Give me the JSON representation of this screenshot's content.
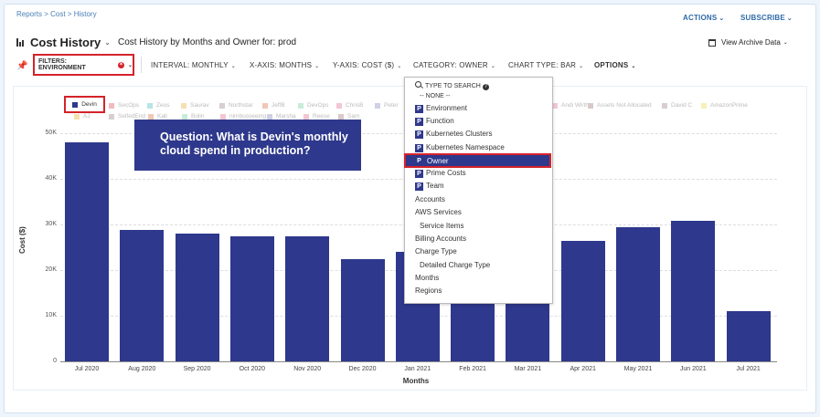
{
  "breadcrumb": "Reports > Cost > History",
  "header": {
    "actions_label": "ACTIONS",
    "subscribe_label": "SUBSCRIBE",
    "title": "Cost History",
    "subtitle": "Cost History by Months and Owner for: prod",
    "archive_label": "View Archive Data"
  },
  "toolbar": {
    "filter_label": "FILTERS: ENVIRONMENT",
    "interval_label": "INTERVAL:",
    "interval_value": "MONTHLY",
    "xaxis_label": "X-AXIS:",
    "xaxis_value": "MONTHS",
    "yaxis_label": "Y-AXIS:",
    "yaxis_value": "COST ($)",
    "category_label": "CATEGORY:",
    "category_value": "OWNER",
    "charttype_label": "CHART TYPE:",
    "charttype_value": "BAR",
    "options_label": "OPTIONS"
  },
  "legend": {
    "row1": [
      "Devin",
      "SecOps",
      "Zeus",
      "Saurav",
      "Northstar",
      "JeffB",
      "DevOps",
      "ChrisB",
      "Peter"
    ],
    "row1_right": [
      "Andi Wirth",
      "Assets Not Allocated",
      "David C",
      "AmazonPrime"
    ],
    "row2": [
      "AJ",
      "SelfedEnd",
      "Kali",
      "Bolin",
      "nimbusseeing",
      "Marsha",
      "Reese",
      "Sam"
    ],
    "colors": [
      "#2e388c",
      "#f4b8c0",
      "#b7e4e6",
      "#f6dfb0",
      "#d7cfcf",
      "#f2c7b5",
      "#c9ecd9",
      "#f3c6d2",
      "#cfd0e6",
      "#f3c6d2",
      "#d9c9c9",
      "#d7cfcf",
      "#f6f0b8"
    ]
  },
  "dropdown": {
    "search_placeholder": "TYPE TO SEARCH",
    "none_label": "-- NONE --",
    "prefixed": [
      "Environment",
      "Function",
      "Kubernetes Clusters",
      "Kubernetes Namespace",
      "Owner",
      "Prime Costs",
      "Team"
    ],
    "badge": "P",
    "selected": "Owner",
    "plain": [
      {
        "label": "Accounts",
        "sub": false
      },
      {
        "label": "AWS Services",
        "sub": false
      },
      {
        "label": "Service Items",
        "sub": true
      },
      {
        "label": "Billing Accounts",
        "sub": false
      },
      {
        "label": "Charge Type",
        "sub": false
      },
      {
        "label": "Detailed Charge Type",
        "sub": true
      },
      {
        "label": "Months",
        "sub": false
      },
      {
        "label": "Regions",
        "sub": false
      }
    ]
  },
  "question": "Question: What is Devin's monthly cloud spend in production?",
  "chart_data": {
    "type": "bar",
    "categories": [
      "Jul 2020",
      "Aug 2020",
      "Sep 2020",
      "Oct 2020",
      "Nov 2020",
      "Dec 2020",
      "Jan 2021",
      "Feb 2021",
      "Mar 2021",
      "Apr 2021",
      "May 2021",
      "Jun 2021",
      "Jul 2021"
    ],
    "series": [
      {
        "name": "Devin",
        "values": [
          48000,
          28800,
          28100,
          27400,
          27400,
          22500,
          24000,
          25500,
          26000,
          26500,
          29500,
          30900,
          11000
        ]
      }
    ],
    "xlabel": "Months",
    "ylabel": "Cost ($)",
    "yticks": [
      "0",
      "10K",
      "20K",
      "30K",
      "40K",
      "50K"
    ],
    "ylim": [
      0,
      50000
    ],
    "grid": true,
    "color": "#2e388c"
  }
}
